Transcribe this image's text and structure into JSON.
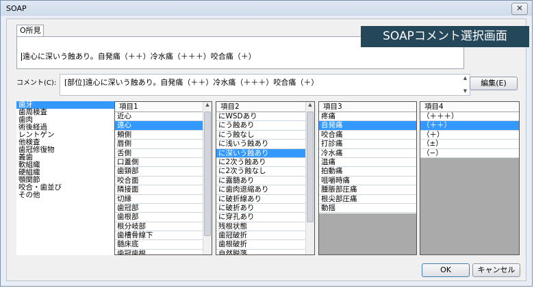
{
  "window": {
    "title": "SOAP",
    "close_glyph": "✕"
  },
  "tab": {
    "label": "O所見"
  },
  "findings": {
    "text": "遠心に深いう蝕あり。自発痛（＋＋）冷水痛（＋＋＋）咬合痛（＋）"
  },
  "overlay": {
    "text": "SOAPコメント選択画面"
  },
  "comment": {
    "label": "コメント(C):",
    "text": "[部位]遠心に深いう蝕あり。自発痛（＋＋）冷水痛（＋＋＋）咬合痛（＋）"
  },
  "edit_button": {
    "label": "編集(E)"
  },
  "categories": [
    "歯牙",
    "歯周検査",
    "歯肉",
    "術後経過",
    "レントゲン",
    "他検査",
    "歯冠修復物",
    "義歯",
    "軟組織",
    "硬組織",
    "顎関節",
    "咬合・歯並び",
    "その他"
  ],
  "col1": {
    "header": "項目1",
    "items": [
      "近心",
      "遠心",
      "頬側",
      "唇側",
      "舌側",
      "口蓋側",
      "歯頸部",
      "咬合面",
      "隣接面",
      "切縁",
      "歯冠部",
      "歯根部",
      "根分岐部",
      "歯槽骨線下",
      "髄床底",
      "歯冠歯根"
    ]
  },
  "col2": {
    "header": "項目2",
    "items": [
      "にWSDあり",
      "にう蝕あり",
      "にう蝕なし",
      "に浅いう蝕あり",
      "に深いう蝕あり",
      "に2次う蝕あり",
      "に2次う蝕なし",
      "に露髄あり",
      "に歯肉退縮あり",
      "に破折線あり",
      "に破折あり",
      "に穿孔あり",
      "残根状態",
      "歯冠破折",
      "歯根破折",
      "自然脱落"
    ]
  },
  "col3": {
    "header": "項目3",
    "items": [
      "疼痛",
      "自発痛",
      "咬合痛",
      "打診痛",
      "冷水痛",
      "温痛",
      "拍動痛",
      "咀嚼時痛",
      "腫脹部圧痛",
      "根尖部圧痛",
      "動揺"
    ]
  },
  "col4": {
    "header": "項目4",
    "items": [
      "（＋＋＋）",
      "（＋＋）",
      "（＋）",
      "（±）",
      "（−）"
    ]
  },
  "footer": {
    "ok": "OK",
    "cancel": "キャンセル"
  }
}
